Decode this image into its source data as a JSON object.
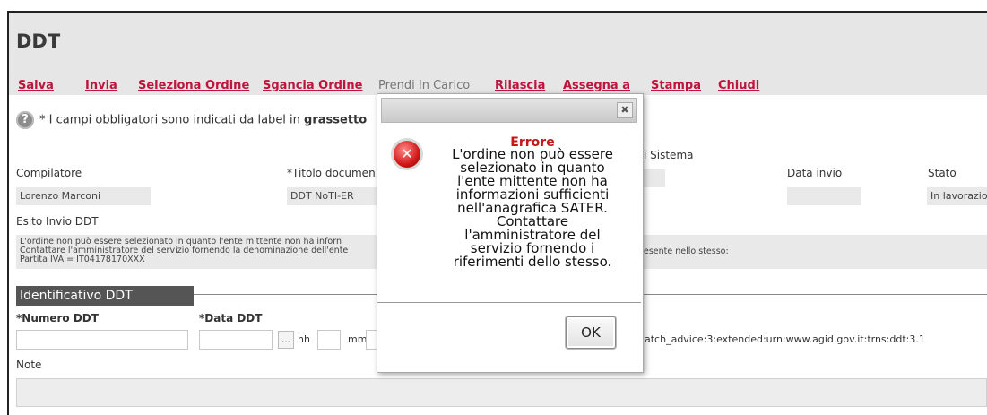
{
  "window": {
    "title": "DDT"
  },
  "toolbar": {
    "items": [
      {
        "label": "Salva",
        "enabled": true
      },
      {
        "label": "Invia",
        "enabled": true
      },
      {
        "label": "Seleziona Ordine",
        "enabled": true
      },
      {
        "label": "Sgancia Ordine",
        "enabled": true
      },
      {
        "label": "Prendi In Carico",
        "enabled": false
      },
      {
        "label": "Rilascia",
        "enabled": true
      },
      {
        "label": "Assegna a",
        "enabled": true
      },
      {
        "label": "Stampa",
        "enabled": true
      },
      {
        "label": "Chiudi",
        "enabled": true
      }
    ]
  },
  "help": {
    "icon": "help-icon",
    "text_before": "* I campi obbligatori sono indicati da label in ",
    "text_bold": "grassetto"
  },
  "header_fields": {
    "compilatore_label": "Compilatore",
    "compilatore_value": "Lorenzo Marconi",
    "titolo_label": "*Titolo documen",
    "titolo_value": "DDT NoTI-ER",
    "sistema_label": "i Sistema",
    "data_invio_label": "Data invio",
    "stato_label": "Stato",
    "stato_value": "In lavorazio"
  },
  "esito": {
    "label": "Esito Invio DDT",
    "text": "L'ordine non può essere selezionato in quanto l'ente mittente non ha inforn\nContattare l'amministratore del servizio fornendo la denominazione dell'ente\nPartita IVA = IT04178170XXX",
    "text_right": "esente nello stesso:"
  },
  "section": {
    "title": "Identificativo DDT"
  },
  "ddt_fields": {
    "numero_label": "*Numero DDT",
    "data_label": "*Data DDT",
    "picker_label": "...",
    "hh_label": "hh",
    "mm_label": "mm",
    "urn_text": "atch_advice:3:extended:urn:www.agid.gov.it:trns:ddt:3.1",
    "note_label": "Note"
  },
  "modal": {
    "close_label": "✖",
    "icon": "error-icon",
    "title": "Errore",
    "message_lines": [
      "L'ordine non può essere",
      "selezionato in quanto",
      "l'ente mittente non ha",
      "informazioni sufficienti",
      "nell'anagrafica SATER.",
      "Contattare",
      "l'amministratore del",
      "servizio fornendo i",
      "riferimenti dello stesso."
    ],
    "ok_label": "OK"
  },
  "colors": {
    "accent": "#c0143c",
    "error": "#c41818",
    "titlebar": "#e6e6e6"
  }
}
